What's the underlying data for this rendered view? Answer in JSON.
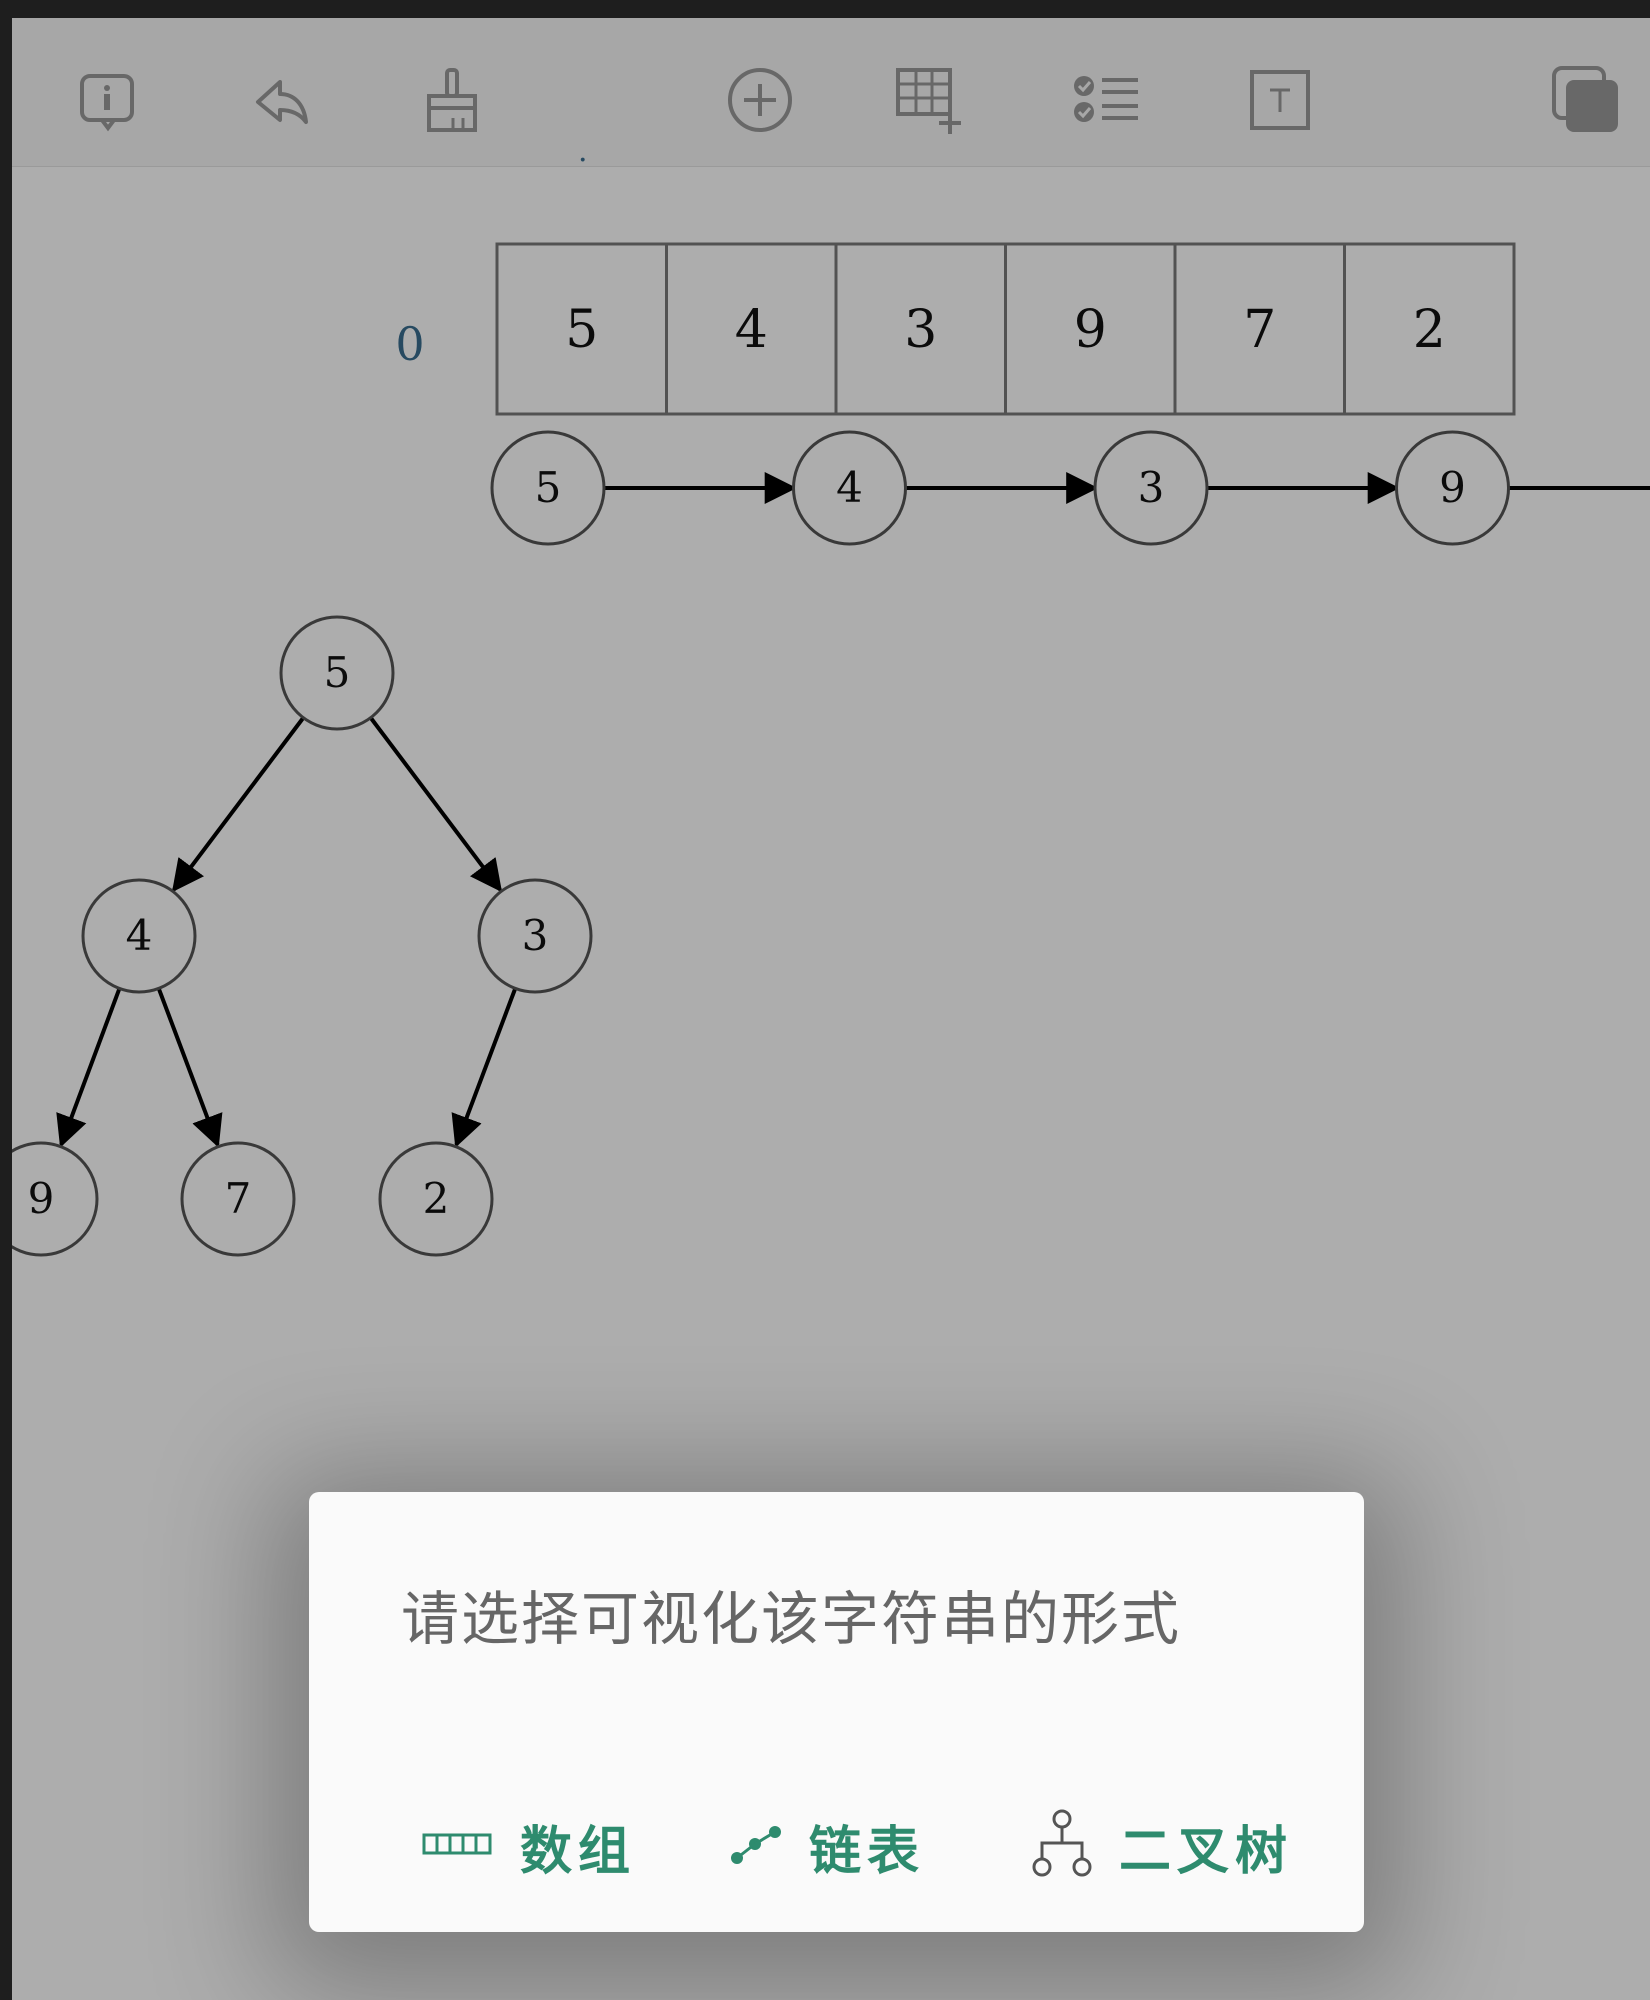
{
  "toolbar": {
    "icons": [
      "info-icon",
      "undo-icon",
      "brush-icon",
      "add-icon",
      "table-add-icon",
      "checklist-icon",
      "text-icon",
      "copy-icon"
    ]
  },
  "array_view": {
    "index_label": "0",
    "cells": [
      "5",
      "4",
      "3",
      "9",
      "7",
      "2"
    ]
  },
  "linked_list": {
    "nodes": [
      "5",
      "4",
      "3",
      "9"
    ]
  },
  "binary_tree": {
    "root": "5",
    "level1": [
      "4",
      "3"
    ],
    "level2": [
      "9",
      "7",
      "2"
    ]
  },
  "dialog": {
    "message": "请选择可视化该字符串的形式",
    "buttons": {
      "array": "数组",
      "linked_list": "链表",
      "binary_tree": "二叉树"
    },
    "accent_color": "#2e8b6e"
  }
}
